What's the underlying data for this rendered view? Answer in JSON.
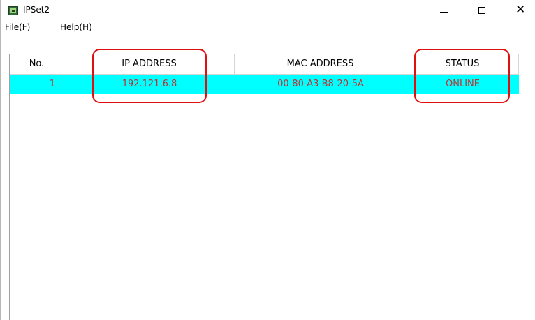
{
  "window": {
    "title": "IPSet2",
    "icon": "lan-icon",
    "controls": {
      "minimize": "minimize",
      "maximize": "maximize",
      "close": "✕"
    }
  },
  "menu": {
    "file": "File(F)",
    "help": "Help(H)"
  },
  "table": {
    "headers": {
      "no": "No.",
      "ip": "IP ADDRESS",
      "mac": "MAC ADDRESS",
      "status": "STATUS"
    },
    "rows": [
      {
        "no": "1",
        "ip": "192.121.6.8",
        "mac": "00-80-A3-B8-20-5A",
        "status": "ONLINE"
      }
    ]
  },
  "colors": {
    "selected_row_bg": "#00ffff",
    "row_text": "#c03030",
    "highlight_border": "#e01010"
  }
}
